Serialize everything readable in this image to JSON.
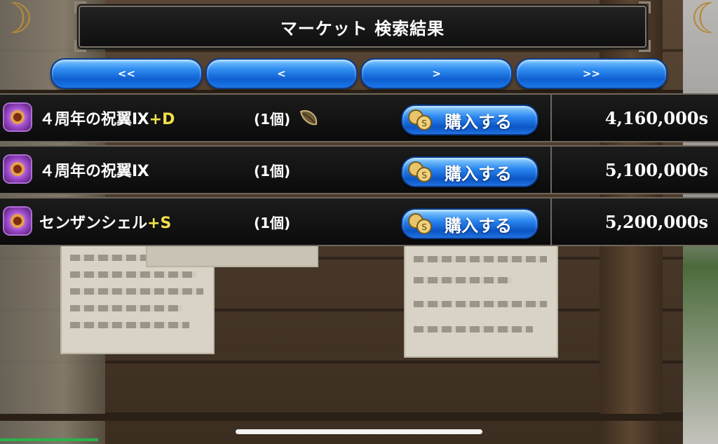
{
  "header": {
    "title": "マーケット 検索結果"
  },
  "pager": {
    "first_label": "<<",
    "prev_label": "<",
    "next_label": ">",
    "last_label": ">>"
  },
  "results": [
    {
      "name": "４周年の祝翼Ⅸ",
      "suffix": "+D",
      "qty": "(1個)",
      "has_seed_icon": true,
      "buy_label": "購入する",
      "price": "4,160,000s"
    },
    {
      "name": "４周年の祝翼Ⅸ",
      "suffix": "",
      "qty": "(1個)",
      "has_seed_icon": false,
      "buy_label": "購入する",
      "price": "5,100,000s"
    },
    {
      "name": "センザンシェル",
      "suffix": "+S",
      "qty": "(1個)",
      "has_seed_icon": false,
      "buy_label": "購入する",
      "price": "5,200,000s"
    }
  ],
  "colors": {
    "button_blue": "#2a86f0",
    "suffix_yellow": "#f2e24a",
    "panel_dark": "#111111",
    "frame_grey": "#6f675c"
  },
  "icons": {
    "item": "ring-item-icon",
    "seed": "seed-icon",
    "buy": "coins-icon"
  }
}
